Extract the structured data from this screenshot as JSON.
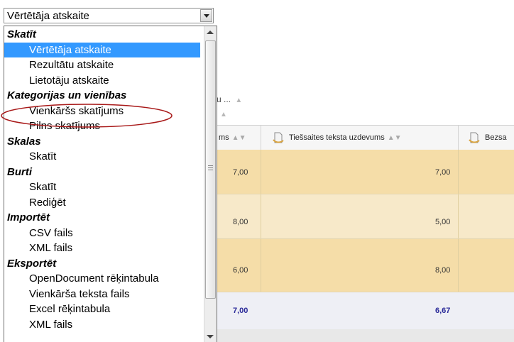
{
  "select": {
    "value": "Vērtētāja atskaite"
  },
  "dropdown": {
    "options": [
      {
        "type": "group",
        "label": "Skatīt"
      },
      {
        "type": "item",
        "label": "Vērtētāja atskaite",
        "selected": true
      },
      {
        "type": "item",
        "label": "Rezultātu atskaite"
      },
      {
        "type": "item",
        "label": "Lietotāju atskaite"
      },
      {
        "type": "group",
        "label": "Kategorijas un vienības"
      },
      {
        "type": "item",
        "label": "Vienkāršs skatījums"
      },
      {
        "type": "item",
        "label": "Pilns skatījums"
      },
      {
        "type": "group",
        "label": "Skalas"
      },
      {
        "type": "item",
        "label": "Skatīt"
      },
      {
        "type": "group",
        "label": "Burti"
      },
      {
        "type": "item",
        "label": "Skatīt"
      },
      {
        "type": "item",
        "label": "Rediģēt"
      },
      {
        "type": "group",
        "label": "Importēt"
      },
      {
        "type": "item",
        "label": "CSV fails"
      },
      {
        "type": "item",
        "label": "XML fails"
      },
      {
        "type": "group",
        "label": "Eksportēt"
      },
      {
        "type": "item",
        "label": "OpenDocument rēķintabula"
      },
      {
        "type": "item",
        "label": "Vienkārša teksta fails"
      },
      {
        "type": "item",
        "label": "Excel rēķintabula"
      },
      {
        "type": "item",
        "label": "XML fails"
      }
    ]
  },
  "table": {
    "crumb": "u ...",
    "headers": [
      "ms",
      "Tiešsaites teksta uzdevums",
      "Bezsa"
    ],
    "rows": [
      [
        "7,00",
        "7,00"
      ],
      [
        "8,00",
        "5,00"
      ],
      [
        "6,00",
        "8,00"
      ]
    ],
    "average": [
      "7,00",
      "6,67"
    ]
  },
  "colors": {
    "row_dark": "#f5dda8",
    "row_light": "#f7e9c9",
    "selection": "#3399ff",
    "annotation": "#a81818"
  }
}
